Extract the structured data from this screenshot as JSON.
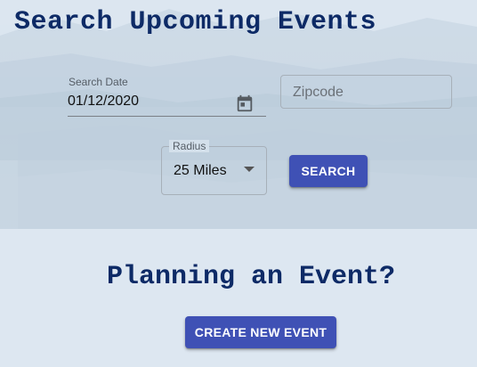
{
  "header": {
    "title": "Search Upcoming Events"
  },
  "search_form": {
    "date_label": "Search Date",
    "date_value": "01/12/2020",
    "zipcode_placeholder": "Zipcode",
    "zipcode_value": "",
    "radius_label": "Radius",
    "radius_value": "25 Miles",
    "search_button": "SEARCH"
  },
  "planning": {
    "heading": "Planning an Event?",
    "create_button": "CREATE NEW EVENT"
  },
  "colors": {
    "primary": "#3f51b5",
    "heading": "#0d2a66",
    "page_background": "#dde7f1"
  },
  "icons": {
    "date_picker": "calendar-icon",
    "radius_dropdown": "caret-down-icon"
  }
}
